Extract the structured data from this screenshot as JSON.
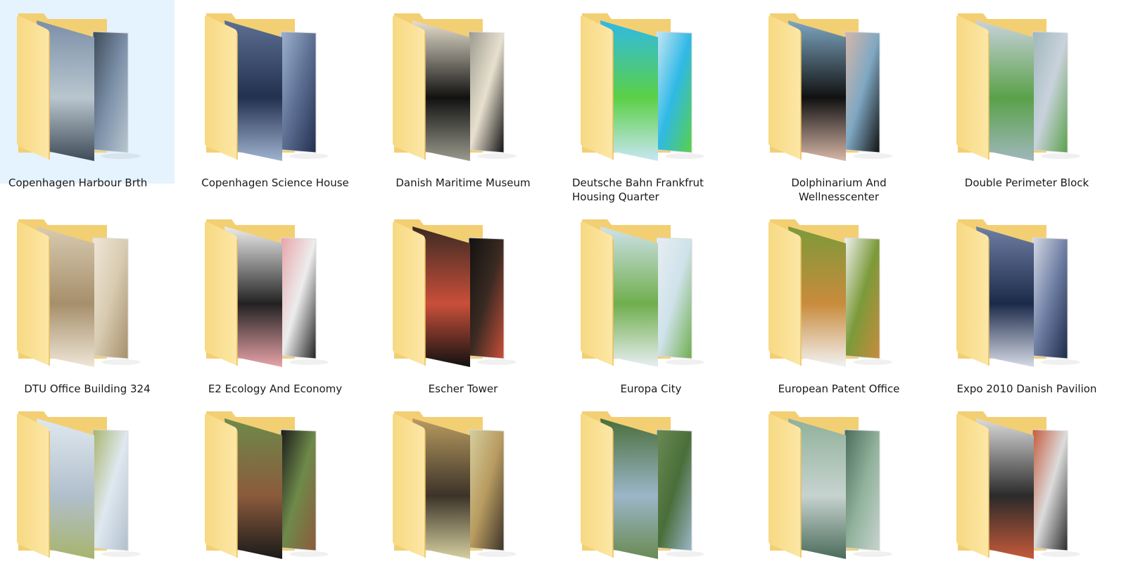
{
  "folders": [
    {
      "label": "Copenhagen Harbour Brth",
      "selected": true,
      "colors": [
        "#7b8fa8",
        "#b9c6cf",
        "#3e4b58"
      ]
    },
    {
      "label": "Copenhagen Science House",
      "selected": false,
      "colors": [
        "#5c6f93",
        "#23304f",
        "#9fb3cf"
      ]
    },
    {
      "label": "Danish Maritime Museum",
      "selected": false,
      "colors": [
        "#e8e0cf",
        "#111111",
        "#9a9a8d"
      ]
    },
    {
      "label": "Deutsche Bahn Frankfrut Housing Quarter",
      "selected": false,
      "colors": [
        "#2fb9e6",
        "#5bd046",
        "#c8e6f4"
      ]
    },
    {
      "label": "Dolphinarium And Wellnesscenter",
      "selected": false,
      "colors": [
        "#7fa8c3",
        "#111111",
        "#d8b7a8"
      ]
    },
    {
      "label": "Double Perimeter Block",
      "selected": false,
      "colors": [
        "#c9d2dc",
        "#5aa14a",
        "#9fb7bb"
      ]
    },
    {
      "label": "DTU Office Building 324",
      "selected": false,
      "colors": [
        "#d8cbb1",
        "#a68f6b",
        "#efe6d6"
      ]
    },
    {
      "label": "E2 Ecology And Economy",
      "selected": false,
      "colors": [
        "#ededed",
        "#222222",
        "#e8a3a8"
      ]
    },
    {
      "label": "Escher Tower",
      "selected": false,
      "colors": [
        "#3a2a22",
        "#c94f3a",
        "#111111"
      ]
    },
    {
      "label": "Europa City",
      "selected": false,
      "colors": [
        "#cfe2ea",
        "#6fae4d",
        "#e8eef2"
      ]
    },
    {
      "label": "European Patent Office",
      "selected": false,
      "colors": [
        "#7b9a3a",
        "#c98b3c",
        "#f2f2f2"
      ]
    },
    {
      "label": "Expo 2010 Danish Pavilion",
      "selected": false,
      "colors": [
        "#6f7fa4",
        "#1c2a4a",
        "#d7dbe6"
      ]
    },
    {
      "label": "",
      "selected": false,
      "colors": [
        "#dfe8ef",
        "#b1bfcc",
        "#a7b46c"
      ]
    },
    {
      "label": "",
      "selected": false,
      "colors": [
        "#6e8a4a",
        "#8b5a3c",
        "#1a1a1a"
      ]
    },
    {
      "label": "",
      "selected": false,
      "colors": [
        "#b89b60",
        "#3c3328",
        "#d6d0a0"
      ]
    },
    {
      "label": "",
      "selected": false,
      "colors": [
        "#4a6e3a",
        "#9bb6c8",
        "#6a8a52"
      ]
    },
    {
      "label": "",
      "selected": false,
      "colors": [
        "#8fb19a",
        "#c7d3cf",
        "#4a6b5a"
      ]
    },
    {
      "label": "",
      "selected": false,
      "colors": [
        "#dcdcdc",
        "#2a2a2a",
        "#c65a3a"
      ]
    }
  ]
}
